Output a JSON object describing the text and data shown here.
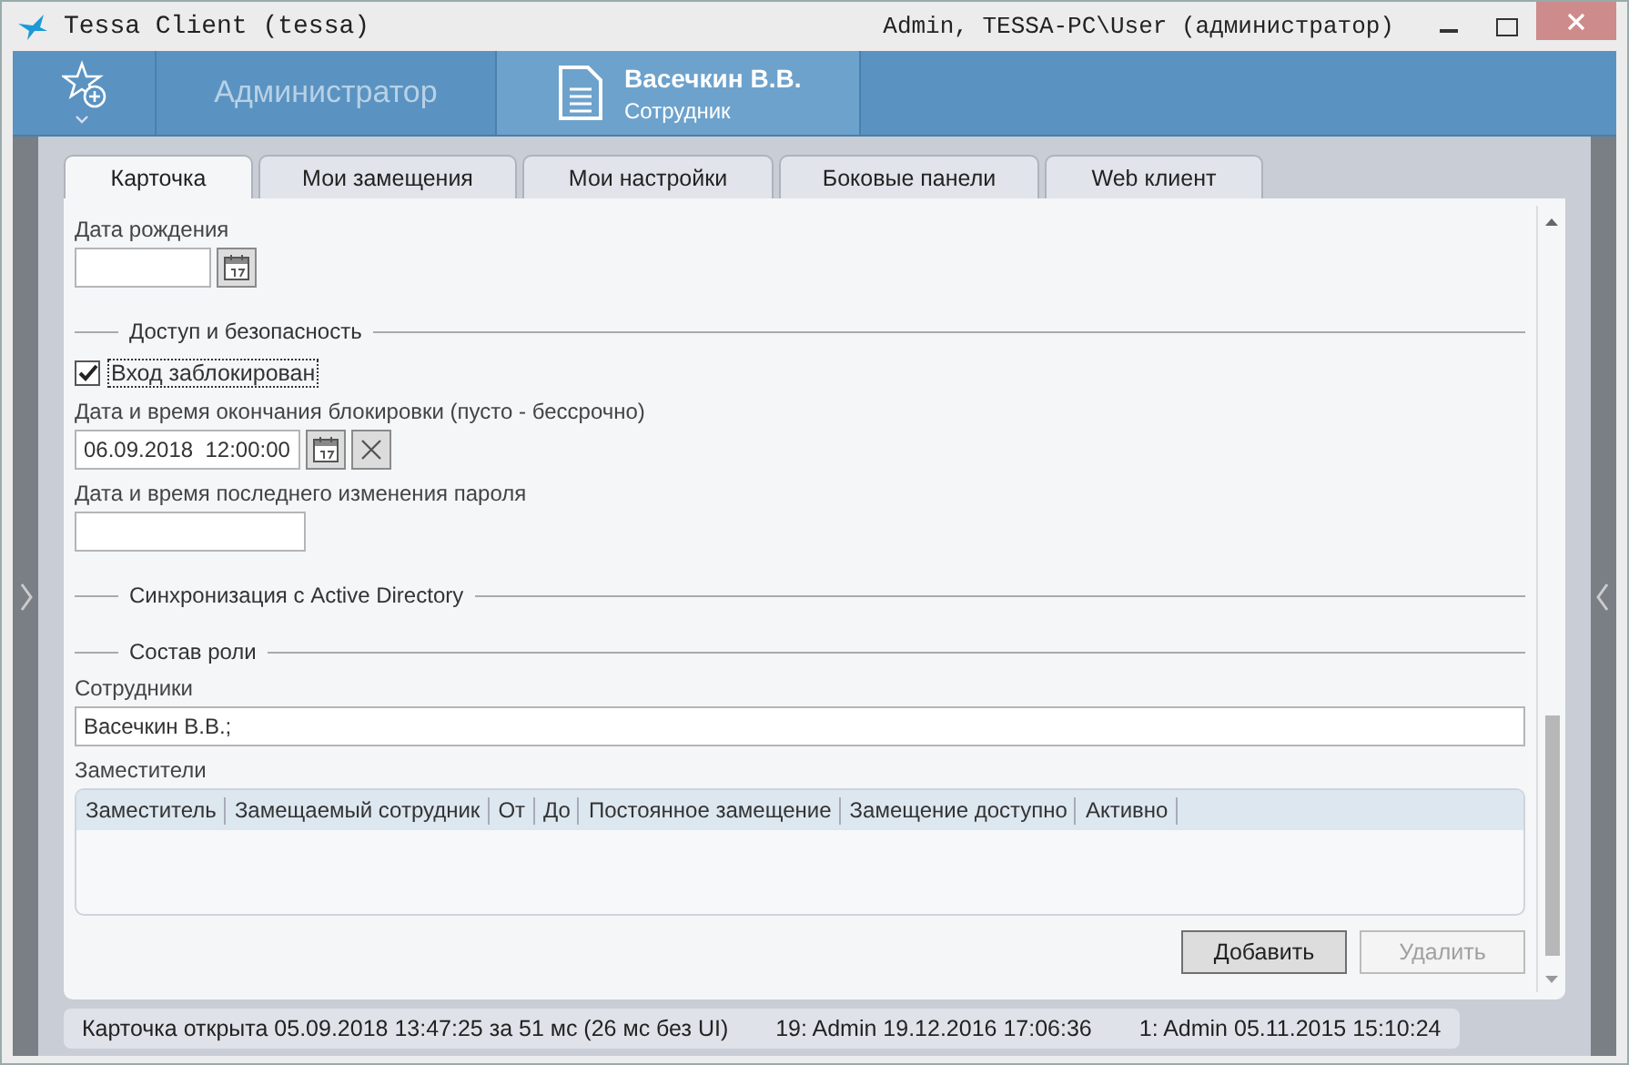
{
  "window": {
    "title": "Tessa Client (tessa)",
    "user": "Admin, TESSA-PC\\User (администратор)"
  },
  "header": {
    "tabs": [
      {
        "kind": "text",
        "label": "Администратор",
        "selected": false
      },
      {
        "kind": "card",
        "title": "Васечкин В.В.",
        "subtitle": "Сотрудник",
        "selected": true
      }
    ]
  },
  "tabs": [
    {
      "label": "Карточка",
      "selected": true
    },
    {
      "label": "Мои замещения",
      "selected": false
    },
    {
      "label": "Мои настройки",
      "selected": false
    },
    {
      "label": "Боковые панели",
      "selected": false
    },
    {
      "label": "Web клиент",
      "selected": false
    }
  ],
  "form": [
    {
      "kind": "date",
      "label": "Дата рождения"
    },
    {
      "kind": "section",
      "label": "Доступ и безопасность"
    },
    {
      "kind": "checkbox",
      "label": "Вход заблокирован",
      "checked": true
    },
    {
      "kind": "datetime",
      "label": "Дата и время окончания блокировки (пусто - бессрочно)",
      "value": "06.09.2018  12:00:00"
    },
    {
      "kind": "text",
      "label": "Дата и время последнего изменения пароля"
    },
    {
      "kind": "section",
      "label": "Синхронизация с Active Directory"
    },
    {
      "kind": "section",
      "label": "Состав роли"
    },
    {
      "kind": "wide",
      "label": "Сотрудники",
      "value": "Васечкин В.В.;"
    },
    {
      "kind": "table",
      "label": "Заместители",
      "columns": [
        "Заместитель",
        "Замещаемый сотрудник",
        "От",
        "До",
        "Постоянное замещение",
        "Замещение доступно",
        "Активно"
      ]
    }
  ],
  "buttons": [
    {
      "label": "Добавить",
      "disabled": false
    },
    {
      "label": "Удалить",
      "disabled": true
    }
  ],
  "status_bar": [
    "Карточка открыта 05.09.2018 13:47:25 за 51 мс (26 мс без UI)",
    "19:  Admin  19.12.2016 17:06:36",
    "1:  Admin  05.11.2015 15:10:24"
  ]
}
